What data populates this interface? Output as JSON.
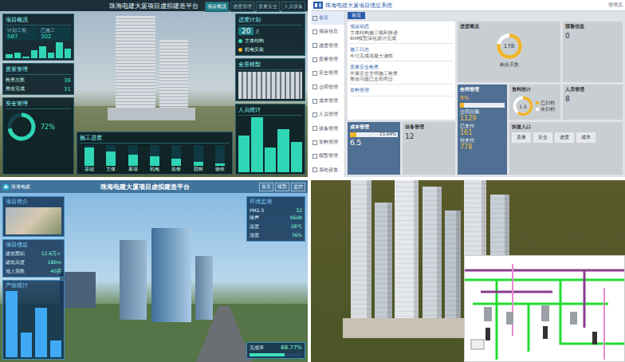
{
  "tl": {
    "title": "珠海电建大厦项目虚拟建造平台",
    "nav": [
      {
        "label": "项目概况",
        "selected": true
      },
      {
        "label": "进度管理",
        "selected": false
      },
      {
        "label": "质量安全",
        "selected": false
      },
      {
        "label": "人员设备",
        "selected": false
      }
    ],
    "overview": {
      "title": "项目概况",
      "stats": [
        {
          "label": "计划工期",
          "value": "587"
        },
        {
          "label": "已施工",
          "value": "302"
        }
      ],
      "series": [
        2,
        3,
        1,
        4,
        6,
        3,
        8,
        5
      ]
    },
    "quality": {
      "title": "质量管理",
      "rows": [
        {
          "label": "检查次数",
          "value": "36"
        },
        {
          "label": "整改完成",
          "value": "31"
        }
      ]
    },
    "safety": {
      "title": "安全管理",
      "level": 0.72,
      "reading": "72%"
    },
    "schedule": {
      "title": "进度计划",
      "value": "20",
      "unit": "天",
      "items": [
        {
          "label": "主体结构",
          "done": true
        },
        {
          "label": "机电安装",
          "done": false
        }
      ]
    },
    "model": {
      "title": "全景模型"
    },
    "progress": {
      "title": "施工进度",
      "bars": [
        {
          "label": "基础",
          "level": 0.9
        },
        {
          "label": "主体",
          "level": 0.7
        },
        {
          "label": "幕墙",
          "level": 0.55
        },
        {
          "label": "机电",
          "level": 0.45
        },
        {
          "label": "装修",
          "level": 0.35
        },
        {
          "label": "园林",
          "level": 0.2
        },
        {
          "label": "验收",
          "level": 0.1
        }
      ]
    },
    "people": {
      "title": "人员统计",
      "series": [
        6,
        9,
        4,
        7,
        5
      ]
    }
  },
  "tr": {
    "title": "珠海电建大厦项目信息系统",
    "user": "管理员",
    "sidebar": [
      {
        "label": "首页",
        "selected": true
      },
      {
        "label": "项目信息",
        "selected": false
      },
      {
        "label": "进度管理",
        "selected": false
      },
      {
        "label": "质量管理",
        "selected": false
      },
      {
        "label": "安全管理",
        "selected": false
      },
      {
        "label": "合同管理",
        "selected": false
      },
      {
        "label": "成本管理",
        "selected": false
      },
      {
        "label": "人员管理",
        "selected": false
      },
      {
        "label": "设备管理",
        "selected": false
      },
      {
        "label": "资料管理",
        "selected": false
      },
      {
        "label": "模型管理",
        "selected": false
      },
      {
        "label": "系统设置",
        "selected": false
      }
    ],
    "tab": {
      "label": "首页",
      "selected": true
    },
    "news": [
      {
        "title": "项目动态",
        "items": [
          "主体结构施工顺利推进",
          "BIM模型深化设计完成"
        ]
      },
      {
        "title": "施工日志",
        "items": [
          "今日完成混凝土浇筑"
        ]
      },
      {
        "title": "质量安全检查",
        "items": [
          "开展安全文明施工检查",
          "整改问题已全部闭合"
        ]
      },
      {
        "title": "资料管理",
        "items": []
      }
    ],
    "plan": {
      "title": "进度概况",
      "value": "178",
      "level": 0.78,
      "caption": "剩余天数"
    },
    "warn": {
      "title": "预警信息",
      "value": "0"
    },
    "contract": {
      "title": "合同管理",
      "percent": "9%",
      "level": 0.09,
      "values": [
        {
          "label": "合同总额",
          "value": "1129"
        },
        {
          "label": "已支付",
          "value": "161"
        },
        {
          "label": "待支付",
          "value": "778"
        }
      ]
    },
    "docs": {
      "title": "资料统计",
      "value": "1.5",
      "level": 0.6,
      "legend": [
        "已归档",
        "未归档"
      ]
    },
    "personnel": {
      "title": "人员管理",
      "value": "8"
    },
    "cost": {
      "title": "成本管理",
      "percent": "13.84%",
      "level": 0.1384,
      "value": "6.5"
    },
    "device": {
      "title": "设备管理",
      "value": "12"
    },
    "shortcuts": {
      "title": "快捷入口",
      "buttons": [
        "质量",
        "安全",
        "进度",
        "成本"
      ]
    }
  },
  "bl": {
    "title": "珠海电建大厦项目虚拟建造平台",
    "brand": "珠海电建",
    "nav": [
      "首页",
      "模型",
      "监控"
    ],
    "intro": {
      "title": "项目简介"
    },
    "info": {
      "title": "项目信息",
      "rows": [
        {
          "label": "建筑面积",
          "value": "12.6万㎡"
        },
        {
          "label": "建筑高度",
          "value": "180m"
        },
        {
          "label": "地上层数",
          "value": "40层"
        }
      ]
    },
    "chart": {
      "title": "产值统计",
      "series": [
        8,
        3,
        6,
        2
      ]
    },
    "monitor": {
      "title": "环境监测",
      "rows": [
        {
          "label": "PM2.5",
          "value": "32"
        },
        {
          "label": "噪声",
          "value": "56dB"
        },
        {
          "label": "温度",
          "value": "28℃"
        },
        {
          "label": "湿度",
          "value": "76%"
        }
      ]
    },
    "rate": {
      "label": "完成率",
      "value": "66.77%",
      "level": 0.6677
    }
  }
}
